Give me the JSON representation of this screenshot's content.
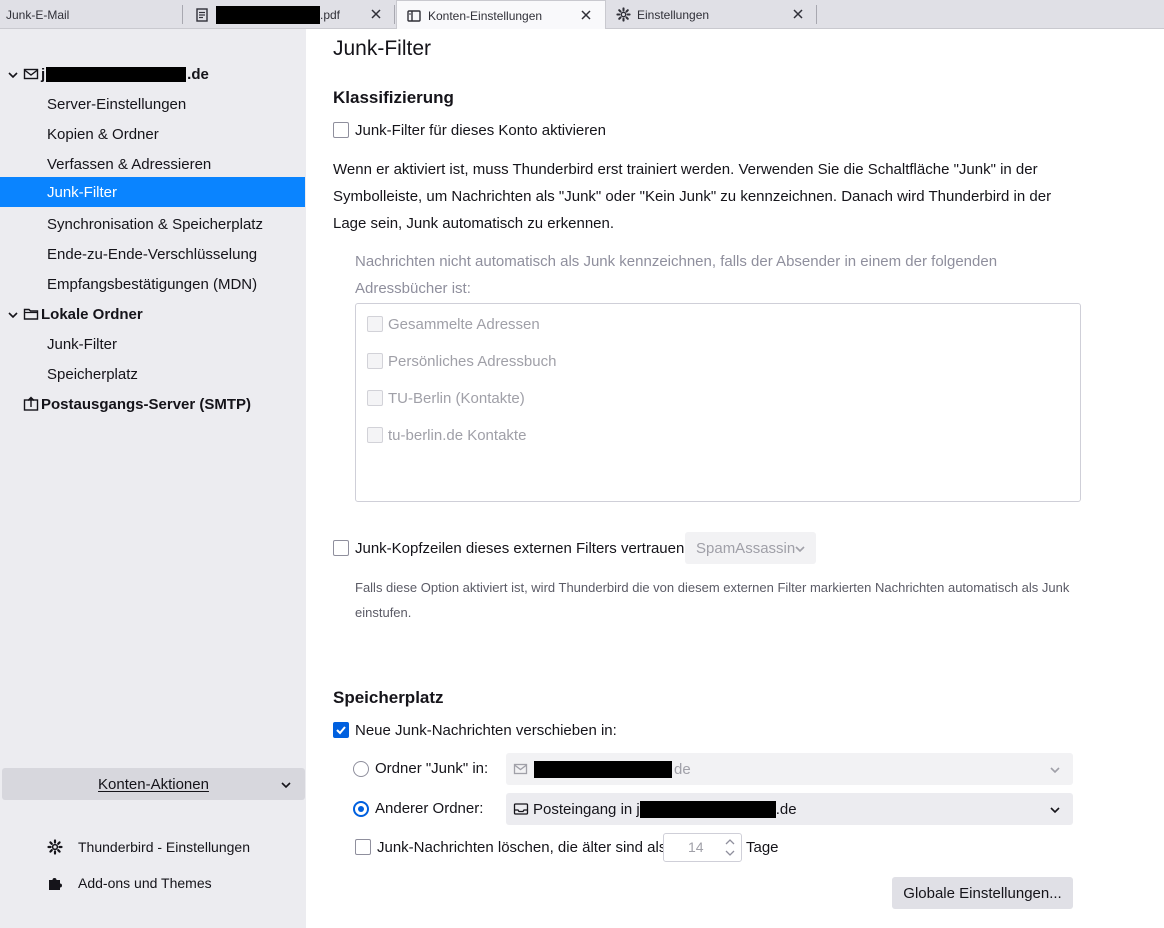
{
  "tabs": [
    {
      "label": "Junk-E-Mail"
    },
    {
      "label_suffix": ".pdf"
    },
    {
      "label": "Konten-Einstellungen"
    },
    {
      "label": "Einstellungen"
    }
  ],
  "sidebar": {
    "account": {
      "prefix": "j",
      "suffix": ".de"
    },
    "account_items": [
      {
        "label": "Server-Einstellungen"
      },
      {
        "label": "Kopien & Ordner"
      },
      {
        "label": "Verfassen & Adressieren"
      },
      {
        "label": "Junk-Filter"
      },
      {
        "label": "Synchronisation & Speicherplatz"
      },
      {
        "label": "Ende-zu-Ende-Verschlüsselung"
      },
      {
        "label": "Empfangsbestätigungen (MDN)"
      }
    ],
    "local_folders": {
      "label": "Lokale Ordner"
    },
    "local_items": [
      {
        "label": "Junk-Filter"
      },
      {
        "label": "Speicherplatz"
      }
    ],
    "smtp": {
      "label": "Postausgangs-Server (SMTP)"
    },
    "account_actions": "Konten-Aktionen",
    "footer": [
      {
        "label": "Thunderbird - Einstellungen"
      },
      {
        "label": "Add-ons und Themes"
      }
    ]
  },
  "main": {
    "page_title": "Junk-Filter",
    "classification": {
      "title": "Klassifizierung",
      "enable_label": "Junk-Filter für dieses Konto aktivieren",
      "enable_checked": false,
      "description": "Wenn er aktiviert ist, muss Thunderbird erst trainiert werden. Verwenden Sie die Schaltfläche \"Junk\" in der Symbolleiste, um Nachrichten als \"Junk\" oder \"Kein Junk\" zu kennzeichnen. Danach wird Thunderbird in der Lage sein, Junk automatisch zu erkennen.",
      "whitelist_text": "Nachrichten nicht automatisch als Junk kennzeichnen, falls der Absender in einem der folgenden Adressbücher ist:",
      "address_books": [
        {
          "label": "Gesammelte Adressen"
        },
        {
          "label": "Persönliches Adressbuch"
        },
        {
          "label": "TU-Berlin (Kontakte)"
        },
        {
          "label": "tu-berlin.de Kontakte"
        }
      ],
      "trust_headers_label": "Junk-Kopfzeilen dieses externen Filters vertrauen:",
      "trust_headers_value": "SpamAssassin",
      "trust_headers_note": "Falls diese Option aktiviert ist, wird Thunderbird die von diesem externen Filter markierten Nachrichten automatisch als Junk einstufen."
    },
    "storage": {
      "title": "Speicherplatz",
      "move_label": "Neue Junk-Nachrichten verschieben in:",
      "move_checked": true,
      "folder_junk_label": "Ordner \"Junk\" in:",
      "folder_junk_value_suffix": "de",
      "other_folder_label": "Anderer Ordner:",
      "other_folder_value_prefix": "Posteingang in j",
      "other_folder_value_suffix": ".de",
      "delete_label": "Junk-Nachrichten löschen, die älter sind als",
      "delete_days": "14",
      "days_unit": "Tage",
      "global_button": "Globale Einstellungen..."
    }
  },
  "colors": {
    "accent": "#0a84ff",
    "checkbox_checked": "#0060df"
  }
}
